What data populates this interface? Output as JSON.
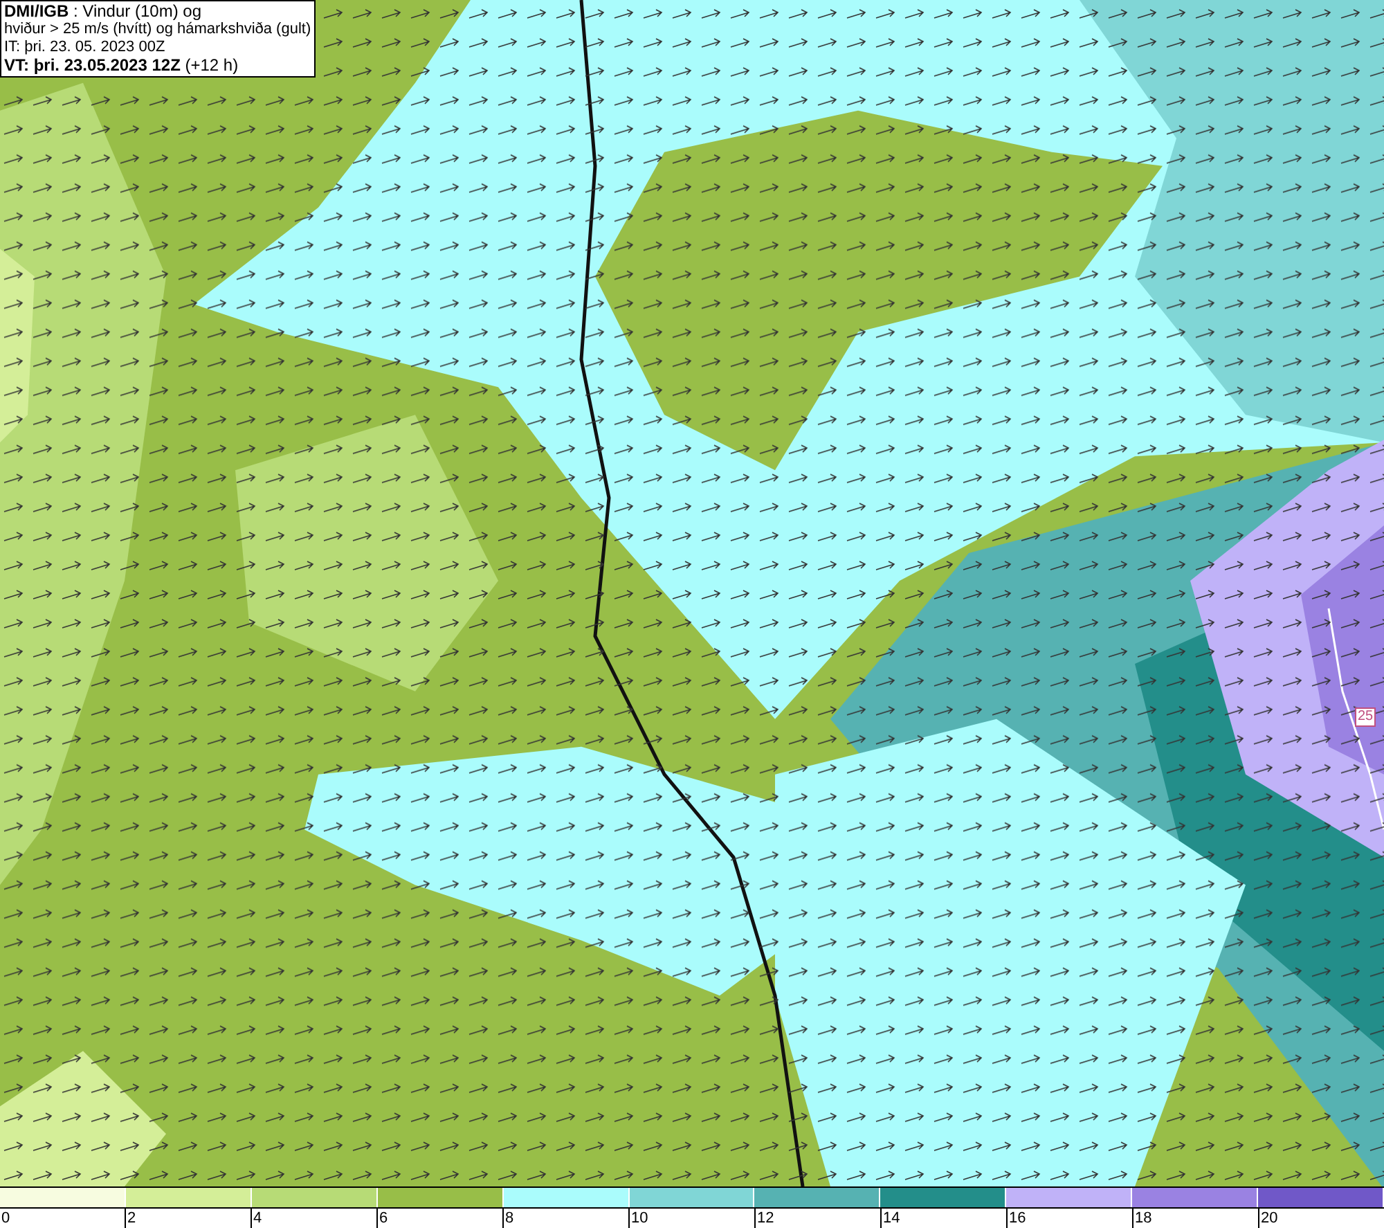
{
  "header": {
    "lines": [
      "**DMI/IGB** : Vindur (10m) og",
      "hviður > 25 m/s (hvítt) og hámarkshviða (gult)",
      "IT: þri. 23. 05. 2023 00Z",
      "**VT: þri. 23.05.2023 12Z** (+12 h)"
    ]
  },
  "map": {
    "road_marker": "25"
  },
  "legend": {
    "bins": [
      {
        "label": "0",
        "color": "#f7fce0"
      },
      {
        "label": "2",
        "color": "#d4ee98"
      },
      {
        "label": "4",
        "color": "#b7db76"
      },
      {
        "label": "6",
        "color": "#98be48"
      },
      {
        "label": "8",
        "color": "#aafcfc"
      },
      {
        "label": "10",
        "color": "#80d6d6"
      },
      {
        "label": "12",
        "color": "#56b2b2"
      },
      {
        "label": "14",
        "color": "#238e8a"
      },
      {
        "label": "16",
        "color": "#c0b2f8"
      },
      {
        "label": "18",
        "color": "#9a82e2"
      },
      {
        "label": "20",
        "color": "#7058c8"
      }
    ]
  }
}
